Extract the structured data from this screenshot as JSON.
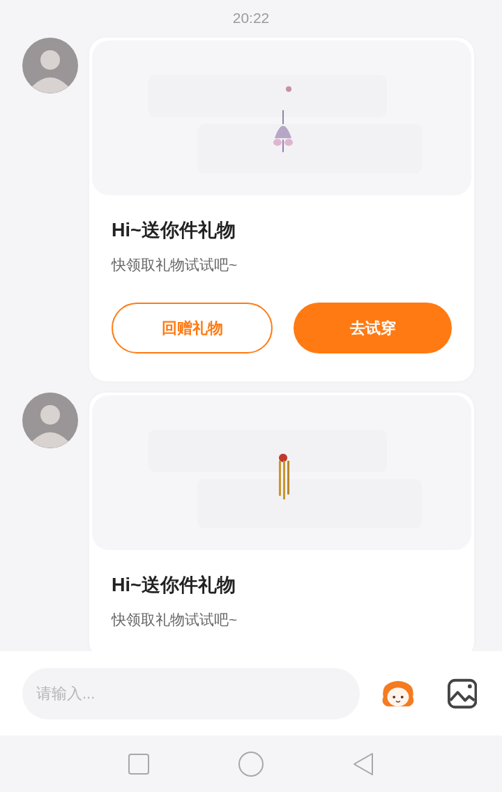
{
  "timestamp": "20:22",
  "messages": [
    {
      "title": "Hi~送你件礼物",
      "subtitle": "快领取礼物试试吧~",
      "buttons": [
        {
          "label": "回赠礼物",
          "kind": "outline"
        },
        {
          "label": "去试穿",
          "kind": "filled"
        }
      ]
    },
    {
      "title": "Hi~送你件礼物",
      "subtitle": "快领取礼物试试吧~"
    }
  ],
  "input": {
    "placeholder": "请输入..."
  }
}
